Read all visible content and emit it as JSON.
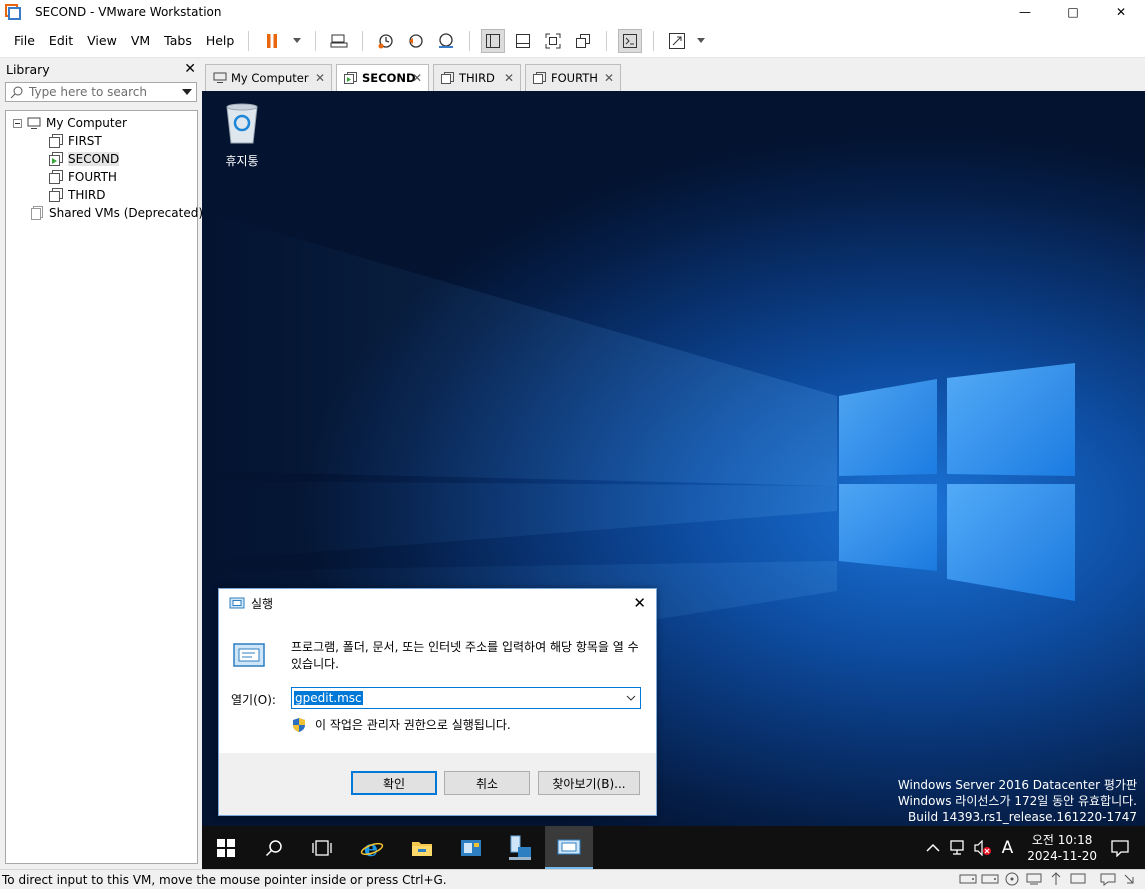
{
  "window": {
    "title": "SECOND - VMware Workstation"
  },
  "menu": {
    "items": [
      "File",
      "Edit",
      "View",
      "VM",
      "Tabs",
      "Help"
    ]
  },
  "library": {
    "title": "Library",
    "search_placeholder": "Type here to search",
    "tree": {
      "root": "My Computer",
      "vms": [
        "FIRST",
        "SECOND",
        "FOURTH",
        "THIRD"
      ],
      "shared": "Shared VMs (Deprecated)"
    }
  },
  "tabs": [
    "My Computer",
    "SECOND",
    "THIRD",
    "FOURTH"
  ],
  "desktop": {
    "recycle_bin": "휴지통",
    "watermark": [
      "Windows Server 2016 Datacenter 평가판",
      "Windows 라이선스가 172일 동안 유효합니다.",
      "Build 14393.rs1_release.161220-1747"
    ]
  },
  "run_dialog": {
    "title": "실행",
    "description": "프로그램, 폴더, 문서, 또는 인터넷 주소를 입력하여 해당 항목을 열 수 있습니다.",
    "open_label": "열기(O):",
    "open_value": "gpedit.msc",
    "admin_note": "이 작업은 관리자 권한으로 실행됩니다.",
    "buttons": {
      "ok": "확인",
      "cancel": "취소",
      "browse": "찾아보기(B)..."
    }
  },
  "taskbar": {
    "clock": {
      "time": "오전 10:18",
      "date": "2024-11-20"
    },
    "ime": "A"
  },
  "statusbar": {
    "message": "To direct input to this VM, move the mouse pointer inside or press Ctrl+G."
  },
  "colors": {
    "accent": "#0078d7",
    "pause": "#e8660c",
    "taskbar": "#101010"
  }
}
